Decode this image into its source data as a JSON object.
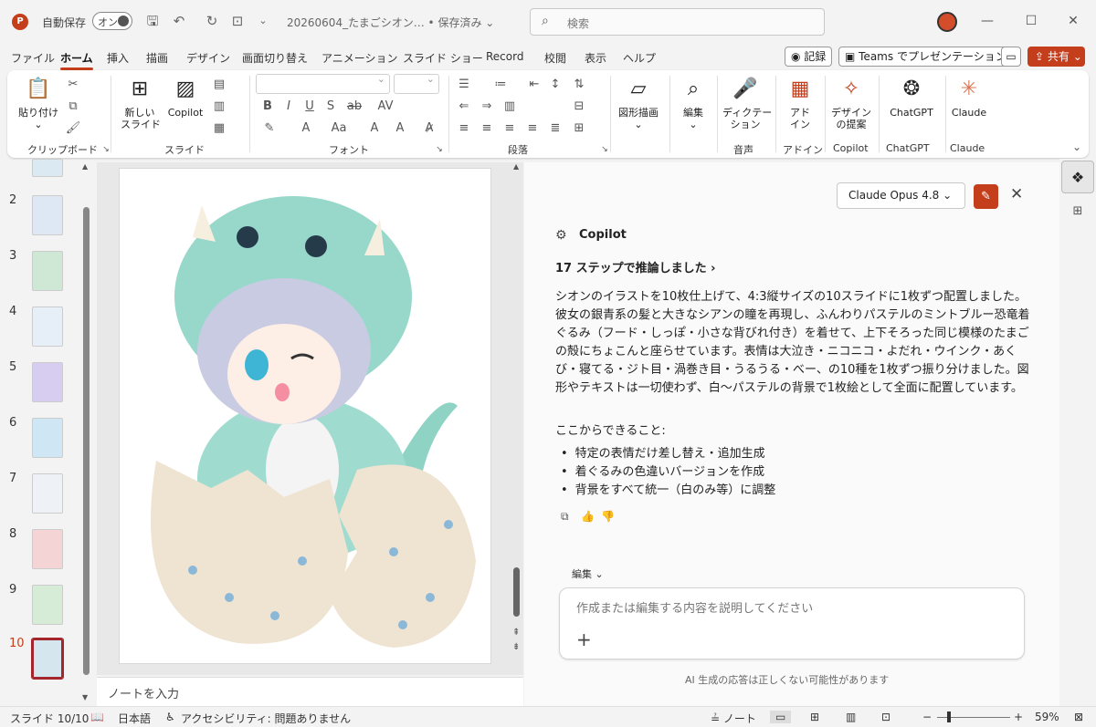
{
  "titlebar": {
    "app_icon": "P",
    "autosave_label": "自動保存",
    "autosave_toggle": "オン",
    "doc_title": "20260604_たまごシオン… ",
    "save_status": "• 保存済み ⌄",
    "search_placeholder": "検索"
  },
  "menu_tabs": [
    {
      "label": "ファイル"
    },
    {
      "label": "ホーム",
      "active": true
    },
    {
      "label": "挿入"
    },
    {
      "label": "描画"
    },
    {
      "label": "デザイン"
    },
    {
      "label": "画面切り替え"
    },
    {
      "label": "アニメーション"
    },
    {
      "label": "スライド ショー"
    },
    {
      "label": "Record"
    },
    {
      "label": "校閲"
    },
    {
      "label": "表示"
    },
    {
      "label": "ヘルプ"
    }
  ],
  "right_buttons": {
    "record": "記録",
    "teams": "Teams でプレゼンテーション",
    "share": "共有"
  },
  "ribbon": {
    "clipboard": {
      "paste": "貼り付け",
      "group": "クリップボード"
    },
    "slides": {
      "new_slide_line1": "新しい",
      "new_slide_line2": "スライド",
      "copilot": "Copilot",
      "group": "スライド"
    },
    "font": {
      "group": "フォント"
    },
    "paragraph": {
      "group": "段落"
    },
    "drawing": {
      "label": "図形描画"
    },
    "edit": {
      "label": "編集"
    },
    "voice": {
      "dictate_line1": "ディクテー",
      "dictate_line2": "ション",
      "group": "音声"
    },
    "addins": {
      "line1": "アド",
      "line2": "イン",
      "group": "アドイン"
    },
    "designer": {
      "line1": "デザイン",
      "line2": "の提案",
      "group": "Copilot"
    },
    "chatgpt": {
      "label": "ChatGPT",
      "group": "ChatGPT"
    },
    "claude": {
      "label": "Claude",
      "group": "Claude"
    }
  },
  "thumbnails": {
    "numbers": [
      "2",
      "3",
      "4",
      "5",
      "6",
      "7",
      "8",
      "9",
      "10"
    ],
    "colors": [
      "#dde8f4",
      "#cfe8d6",
      "#e6eef7",
      "#d6cdf0",
      "#cfe6f4",
      "#eef2f6",
      "#f4d4d4",
      "#d7ecd6",
      "#d5e6ef"
    ],
    "selected": "10"
  },
  "notes": {
    "placeholder": "ノートを入力"
  },
  "copilot": {
    "model": "Claude Opus 4.8  ⌄",
    "title": "Copilot",
    "steps": "17 ステップで推論しました ›",
    "body": "シオンのイラストを10枚仕上げて、4:3縦サイズの10スライドに1枚ずつ配置しました。彼女の銀青系の髪と大きなシアンの瞳を再現し、ふんわりパステルのミントブルー恐竜着ぐるみ（フード・しっぽ・小さな背びれ付き）を着せて、上下そろった同じ模様のたまごの殻にちょこんと座らせています。表情は大泣き・ニコニコ・よだれ・ウインク・あくび・寝てる・ジト目・渦巻き目・うるうる・べー、の10種を1枚ずつ振り分けました。図形やテキストは一切使わず、白〜パステルの背景で1枚絵として全面に配置しています。",
    "subhead": "ここからできること:",
    "bullets": [
      "特定の表情だけ差し替え・追加生成",
      "着ぐるみの色違いバージョンを作成",
      "背景をすべて統一（白のみ等）に調整"
    ],
    "edit_label": "編集 ⌄",
    "input_placeholder": "作成または編集する内容を説明してください",
    "disclaimer": "AI 生成の応答は正しくない可能性があります"
  },
  "statusbar": {
    "slide": "スライド 10/10",
    "language": "日本語",
    "accessibility": "アクセシビリティ: 問題ありません",
    "notes_btn": "ノート",
    "zoom": "59%"
  },
  "colors": {
    "accent": "#c43e1c",
    "selected_thumb": "#a4262c"
  }
}
